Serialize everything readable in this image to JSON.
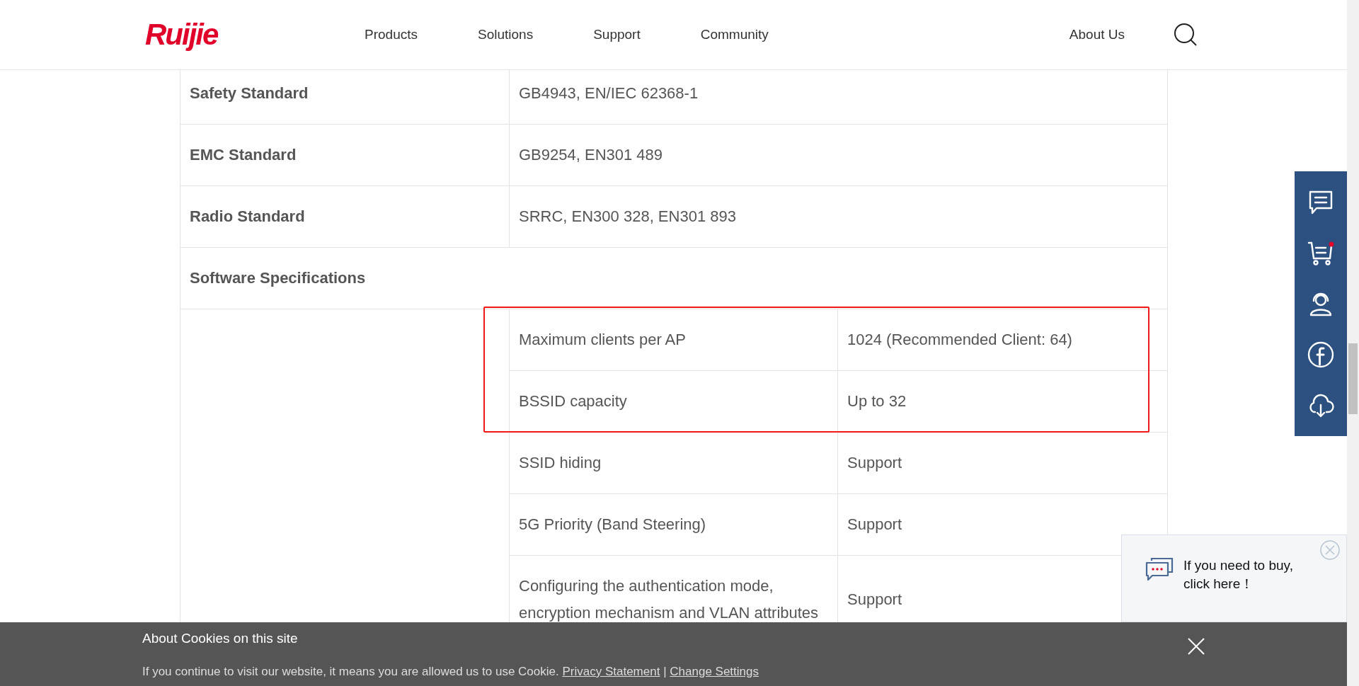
{
  "header": {
    "logo": "Ruijie",
    "nav": [
      "Products",
      "Solutions",
      "Support",
      "Community"
    ],
    "about": "About Us"
  },
  "spec_rows": [
    {
      "kind": "pair",
      "label": "Safety Standard",
      "value": "GB4943, EN/IEC 62368-1"
    },
    {
      "kind": "pair",
      "label": "EMC Standard",
      "value": "GB9254, EN301 489"
    },
    {
      "kind": "pair",
      "label": "Radio Standard",
      "value": "SRRC, EN300 328, EN301 893"
    },
    {
      "kind": "section",
      "label": "Software Specifications"
    }
  ],
  "software_rows": [
    {
      "name": "Maximum clients per AP",
      "value": "1024 (Recommended Client: 64)"
    },
    {
      "name": "BSSID capacity",
      "value": "Up to 32"
    },
    {
      "name": "SSID hiding",
      "value": "Support"
    },
    {
      "name": "5G Priority (Band Steering)",
      "value": "Support"
    },
    {
      "name": "Configuring the authentication mode, encryption mechanism and VLAN attributes",
      "value": "Support"
    }
  ],
  "buy_popup": {
    "lines": [
      "If you need to buy,",
      "click here！"
    ]
  },
  "cookie_bar": {
    "title": "About Cookies on this site",
    "text": "If you continue to visit our website, it means you are allowed us to use Cookie.",
    "links": [
      "Privacy Statement",
      "Change Settings"
    ],
    "separator": "|"
  }
}
